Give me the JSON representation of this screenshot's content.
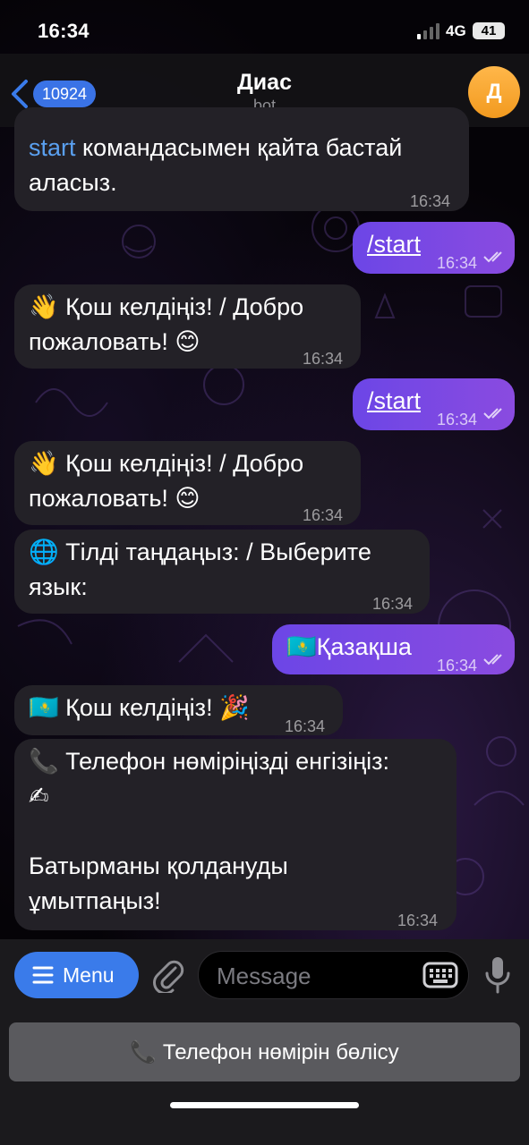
{
  "status_bar": {
    "time": "16:34",
    "network": "4G",
    "battery": "41"
  },
  "header": {
    "back_count": "10924",
    "title": "Диас",
    "subtitle": "bot",
    "avatar_letter": "Д"
  },
  "messages": [
    {
      "direction": "in",
      "link": "start",
      "text": " командасымен қайта бастай",
      "text2": "аласыз.",
      "time": "16:34"
    },
    {
      "direction": "out",
      "text": "/start",
      "time": "16:34"
    },
    {
      "direction": "in",
      "emoji": "👋",
      "text": " Қош келдіңіз! / Добро",
      "text2": "пожаловать! ",
      "emoji2": "😊",
      "time": "16:34"
    },
    {
      "direction": "out",
      "text": "/start",
      "time": "16:34"
    },
    {
      "direction": "in",
      "emoji": "👋",
      "text": " Қош келдіңіз! / Добро",
      "text2": "пожаловать! ",
      "emoji2": "😊",
      "time": "16:34"
    },
    {
      "direction": "in",
      "emoji": "🌐",
      "text": " Тілді таңдаңыз: / Выберите",
      "text2": "язык:",
      "time": "16:34"
    },
    {
      "direction": "out",
      "emoji": "🇰🇿",
      "text": "Қазақша",
      "time": "16:34"
    },
    {
      "direction": "in",
      "emoji": "🇰🇿",
      "text": " Қош келдіңіз! ",
      "emoji2": "🎉",
      "time": "16:34"
    },
    {
      "direction": "in",
      "emoji": "📞",
      "text": " Телефон нөміріңізді енгізіңіз:",
      "emoji2": "✍",
      "text3": "Батырманы қолдануды",
      "text4": "ұмытпаңыз!",
      "time": "16:34"
    }
  ],
  "composer": {
    "menu_label": "Menu",
    "placeholder": "Message"
  },
  "keyboard": {
    "emoji": "📞",
    "button_label": "Телефон нөмірін бөлісу"
  },
  "colors": {
    "accent": "#3a7bea",
    "outgoing_bubble": "#7b49e3",
    "incoming_bubble": "#232127",
    "avatar": "#f5a530"
  }
}
